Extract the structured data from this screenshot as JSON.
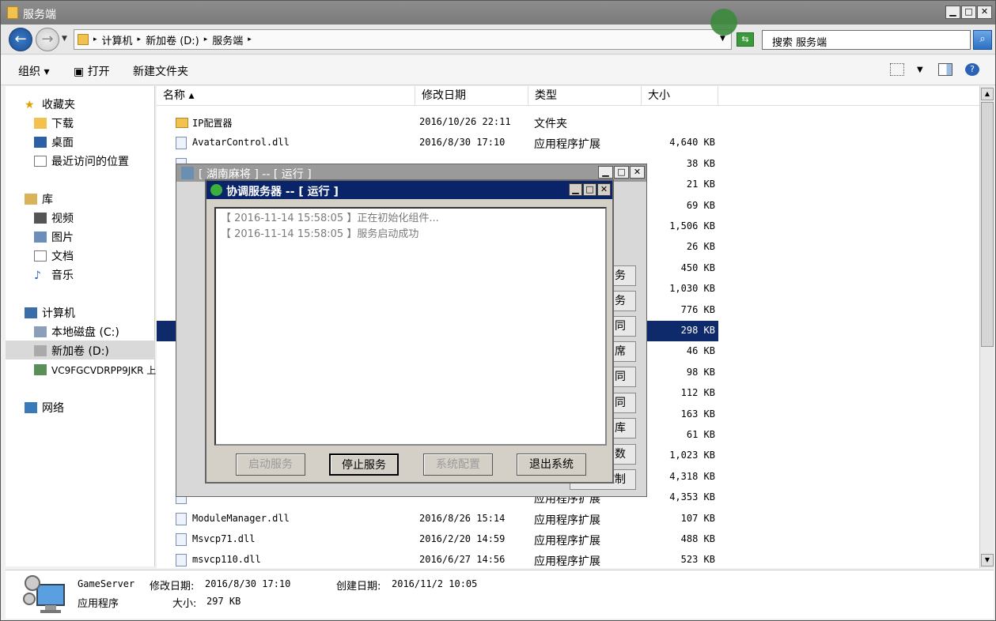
{
  "window": {
    "title": "服务端"
  },
  "address": {
    "crumbs": [
      "计算机",
      "新加卷 (D:)",
      "服务端"
    ],
    "search_placeholder": "搜索 服务端"
  },
  "toolbar": {
    "organize": "组织",
    "open": "打开",
    "new_folder": "新建文件夹"
  },
  "nav": {
    "favorites": "收藏夹",
    "downloads": "下载",
    "desktop": "桌面",
    "recent": "最近访问的位置",
    "libraries": "库",
    "videos": "视频",
    "pictures": "图片",
    "documents": "文档",
    "music": "音乐",
    "computer": "计算机",
    "local_disk": "本地磁盘 (C:)",
    "new_volume": "新加卷 (D:)",
    "network_drive": "VC9FGCVDRPP9JKR 上",
    "network": "网络"
  },
  "columns": {
    "name": "名称",
    "date": "修改日期",
    "type": "类型",
    "size": "大小"
  },
  "files": [
    {
      "name": "IP配置器",
      "date": "2016/10/26 22:11",
      "type": "文件夹",
      "size": "",
      "folder": true
    },
    {
      "name": "AvatarControl.dll",
      "date": "2016/8/30 17:10",
      "type": "应用程序扩展",
      "size": "4,640 KB"
    },
    {
      "name": "",
      "date": "",
      "type": "",
      "size": "38 KB"
    },
    {
      "name": "",
      "date": "",
      "type": "",
      "size": "21 KB"
    },
    {
      "name": "",
      "date": "",
      "type": "",
      "size": "69 KB"
    },
    {
      "name": "",
      "date": "",
      "type": "",
      "size": "1,506 KB"
    },
    {
      "name": "",
      "date": "",
      "type": "",
      "size": "26 KB"
    },
    {
      "name": "",
      "date": "",
      "type": "",
      "size": "450 KB"
    },
    {
      "name": "",
      "date": "",
      "type": "",
      "size": "1,030 KB"
    },
    {
      "name": "",
      "date": "",
      "type": "",
      "size": "776 KB"
    },
    {
      "name": "",
      "date": "",
      "type": "",
      "size": "298 KB",
      "selected": true
    },
    {
      "name": "",
      "date": "",
      "type": "",
      "size": "46 KB"
    },
    {
      "name": "",
      "date": "",
      "type": "",
      "size": "98 KB"
    },
    {
      "name": "",
      "date": "",
      "type": "",
      "size": "112 KB"
    },
    {
      "name": "",
      "date": "",
      "type": "",
      "size": "163 KB"
    },
    {
      "name": "",
      "date": "",
      "type": "",
      "size": "61 KB"
    },
    {
      "name": "",
      "date": "",
      "type": "",
      "size": "1,023 KB"
    },
    {
      "name": "",
      "date": "",
      "type": "",
      "size": "4,318 KB"
    },
    {
      "name": "",
      "date": "",
      "type": "应用程序扩展",
      "size": "4,353 KB"
    },
    {
      "name": "ModuleManager.dll",
      "date": "2016/8/26 15:14",
      "type": "应用程序扩展",
      "size": "107 KB"
    },
    {
      "name": "Msvcp71.dll",
      "date": "2016/2/20 14:59",
      "type": "应用程序扩展",
      "size": "488 KB"
    },
    {
      "name": "msvcp110.dll",
      "date": "2016/6/27 14:56",
      "type": "应用程序扩展",
      "size": "523 KB"
    }
  ],
  "details": {
    "name": "GameServer",
    "mod_label": "修改日期:",
    "mod_date": "2016/8/30 17:10",
    "create_label": "创建日期:",
    "create_date": "2016/11/2 10:05",
    "kind": "应用程序",
    "size_label": "大小:",
    "size": "297 KB"
  },
  "back_dialog": {
    "title": "[ 湖南麻将 ] -- [ 运行 ]",
    "buttons": [
      "务",
      "务",
      "同",
      "席",
      "同",
      "同",
      "库",
      "数",
      "服务控制"
    ]
  },
  "dialog": {
    "title": "协调服务器 -- [ 运行 ]",
    "log": [
      "【 2016-11-14 15:58:05 】正在初始化组件...",
      "【 2016-11-14 15:58:05 】服务启动成功"
    ],
    "start": "启动服务",
    "stop": "停止服务",
    "config": "系统配置",
    "exit": "退出系统"
  }
}
